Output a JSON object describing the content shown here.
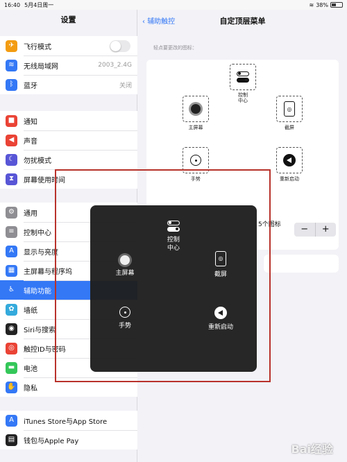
{
  "status": {
    "time": "16:40",
    "date": "5月4日周一",
    "battery": "38%"
  },
  "sidebar": {
    "title": "设置",
    "group1": [
      {
        "label": "飞行模式",
        "icon": "airplane-icon",
        "color": "#f39c12",
        "glyph": "✈",
        "toggle": true
      },
      {
        "label": "无线局域网",
        "icon": "wifi-icon",
        "color": "#3478f6",
        "glyph": "≋",
        "value": "2003_2.4G"
      },
      {
        "label": "蓝牙",
        "icon": "bluetooth-icon",
        "color": "#3478f6",
        "glyph": "ᛒ",
        "value": "关闭"
      }
    ],
    "group2": [
      {
        "label": "通知",
        "icon": "notifications-icon",
        "color": "#ea4335",
        "glyph": "■"
      },
      {
        "label": "声音",
        "icon": "sound-icon",
        "color": "#ea4335",
        "glyph": "◀"
      },
      {
        "label": "勿扰模式",
        "icon": "moon-icon",
        "color": "#5856d6",
        "glyph": "☾"
      },
      {
        "label": "屏幕使用时间",
        "icon": "hourglass-icon",
        "color": "#5856d6",
        "glyph": "⧗"
      }
    ],
    "group3": [
      {
        "label": "通用",
        "icon": "gear-icon",
        "color": "#8e8e93",
        "glyph": "⚙"
      },
      {
        "label": "控制中心",
        "icon": "control-center-icon",
        "color": "#8e8e93",
        "glyph": "≡"
      },
      {
        "label": "显示与亮度",
        "icon": "display-icon",
        "color": "#3478f6",
        "glyph": "A"
      },
      {
        "label": "主屏幕与程序坞",
        "icon": "home-screen-icon",
        "color": "#3478f6",
        "glyph": "▦"
      },
      {
        "label": "辅助功能",
        "icon": "accessibility-icon",
        "color": "#3478f6",
        "glyph": "♿",
        "active": true
      },
      {
        "label": "墙纸",
        "icon": "wallpaper-icon",
        "color": "#34aadc",
        "glyph": "✿"
      },
      {
        "label": "Siri与搜索",
        "icon": "siri-icon",
        "color": "#222222",
        "glyph": "◉"
      },
      {
        "label": "触控ID与密码",
        "icon": "fingerprint-icon",
        "color": "#ea4335",
        "glyph": "◎"
      },
      {
        "label": "电池",
        "icon": "battery-icon",
        "color": "#34c759",
        "glyph": "▬"
      },
      {
        "label": "隐私",
        "icon": "hand-icon",
        "color": "#3478f6",
        "glyph": "✋"
      }
    ],
    "group4": [
      {
        "label": "iTunes Store与App Store",
        "icon": "app-store-icon",
        "color": "#3478f6",
        "glyph": "A"
      },
      {
        "label": "钱包与Apple Pay",
        "icon": "wallet-icon",
        "color": "#222222",
        "glyph": "▤"
      }
    ]
  },
  "detail": {
    "back_label": "辅助触控",
    "title": "自定顶层菜单",
    "hint": "轻点要更改的图标：",
    "slots": {
      "control_center": "控制\n中心",
      "home": "主屏幕",
      "screenshot": "截屏",
      "gesture": "手势",
      "restart": "重新启动"
    },
    "count_label": "5个图标",
    "minus": "−",
    "plus": "+"
  },
  "menu": {
    "control_center": "控制\n中心",
    "home": "主屏幕",
    "screenshot": "截屏",
    "gesture": "手势",
    "restart": "重新启动"
  },
  "watermark": "Bai经验",
  "colors": {
    "accent": "#3478f6",
    "highlight": "#b8322b",
    "menu_bg": "#1e1e1e"
  }
}
